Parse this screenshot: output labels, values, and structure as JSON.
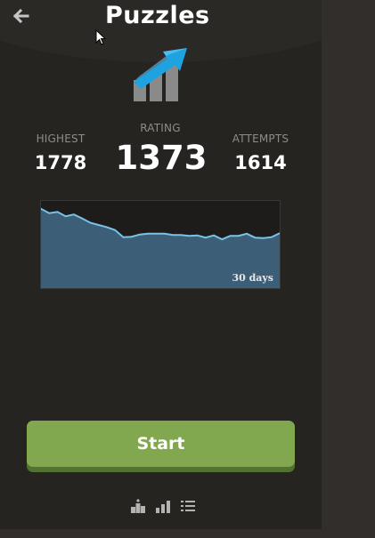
{
  "header": {
    "title": "Puzzles",
    "back_icon": "arrow-left-icon",
    "logo_icon": "rising-arrow-bars-icon"
  },
  "stats": {
    "highest_label": "HIGHEST",
    "highest_value": "1778",
    "rating_label": "RATING",
    "rating_value": "1373",
    "attempts_label": "ATTEMPTS",
    "attempts_value": "1614"
  },
  "chart_data": {
    "type": "area",
    "range_label": "30 days",
    "x": [
      1,
      2,
      3,
      4,
      5,
      6,
      7,
      8,
      9,
      10,
      11,
      12,
      13,
      14,
      15,
      16,
      17,
      18,
      19,
      20,
      21,
      22,
      23,
      24,
      25,
      26,
      27,
      28,
      29,
      30
    ],
    "values": [
      1462,
      1452,
      1455,
      1445,
      1449,
      1440,
      1430,
      1425,
      1420,
      1413,
      1397,
      1398,
      1403,
      1405,
      1405,
      1405,
      1402,
      1402,
      1400,
      1401,
      1396,
      1401,
      1392,
      1400,
      1400,
      1405,
      1396,
      1395,
      1397,
      1406
    ],
    "ylim": [
      1280,
      1480
    ],
    "grid": false,
    "colors": {
      "line": "#79c2e8",
      "fill": "#3d5e77"
    }
  },
  "actions": {
    "start_label": "Start"
  },
  "bottom_icons": [
    "trophy-leaderboard-icon",
    "bar-chart-icon",
    "list-icon"
  ],
  "colors": {
    "panel": "#262421",
    "background": "#312e2b",
    "start_button": "#81a84f",
    "start_button_shadow": "#537133",
    "logo_arrow": "#1fa3e0"
  }
}
